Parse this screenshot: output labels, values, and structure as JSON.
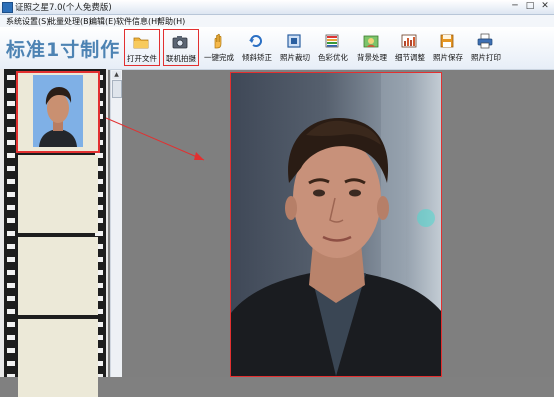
{
  "window": {
    "title": "证照之星7.0(个人免费版)",
    "buttons": [
      "─",
      "□",
      "✕"
    ]
  },
  "menu": [
    "系统设置(S)",
    "批量处理(B)",
    "编辑(E)",
    "软件信息(H)",
    "帮助(H)"
  ],
  "brand": "标准1寸制作",
  "toolbar": [
    {
      "label": "打开文件",
      "icon": "folder-icon",
      "highlighted": true
    },
    {
      "label": "联机拍摄",
      "icon": "camera-icon",
      "highlighted": true
    },
    {
      "label": "一键完成",
      "icon": "hand-icon",
      "highlighted": false
    },
    {
      "label": "倾斜矫正",
      "icon": "rotate-icon",
      "highlighted": false
    },
    {
      "label": "照片裁切",
      "icon": "crop-icon",
      "highlighted": false
    },
    {
      "label": "色彩优化",
      "icon": "color-icon",
      "highlighted": false
    },
    {
      "label": "背景处理",
      "icon": "background-icon",
      "highlighted": false
    },
    {
      "label": "细节调整",
      "icon": "detail-icon",
      "highlighted": false
    },
    {
      "label": "照片保存",
      "icon": "save-icon",
      "highlighted": false
    },
    {
      "label": "照片打印",
      "icon": "printer-icon",
      "highlighted": false
    }
  ],
  "colors": {
    "accent": "#e23030",
    "brand": "#4d83b3",
    "canvas": "#7f7f7f"
  },
  "filmstrip": {
    "frames": 4,
    "selected": 0
  }
}
